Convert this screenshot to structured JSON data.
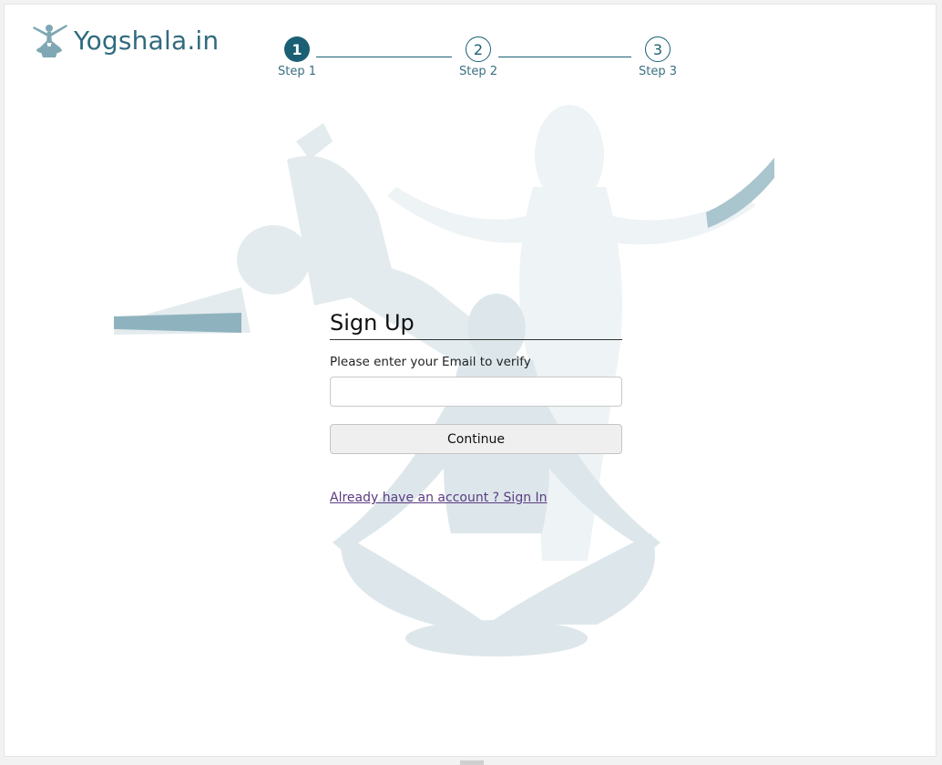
{
  "brand": {
    "name": "Yogshala.in"
  },
  "stepper": {
    "steps": [
      {
        "number": "1",
        "label": "Step 1",
        "state": "active"
      },
      {
        "number": "2",
        "label": "Step 2",
        "state": "inactive"
      },
      {
        "number": "3",
        "label": "Step 3",
        "state": "inactive"
      }
    ]
  },
  "form": {
    "title": "Sign Up",
    "prompt": "Please enter your Email to verify",
    "email_value": "",
    "continue_label": "Continue",
    "signin_link": "Already have an account ? Sign In"
  },
  "colors": {
    "accent": "#1a5f74",
    "brand_text": "#2f6b7e",
    "link": "#5b3b82",
    "silhouette_light": "#e6eef1",
    "silhouette_dark": "#8fb3be"
  },
  "icons": {
    "logo": "yoga-pose-logo-icon",
    "background": "yoga-silhouettes-illustration"
  }
}
